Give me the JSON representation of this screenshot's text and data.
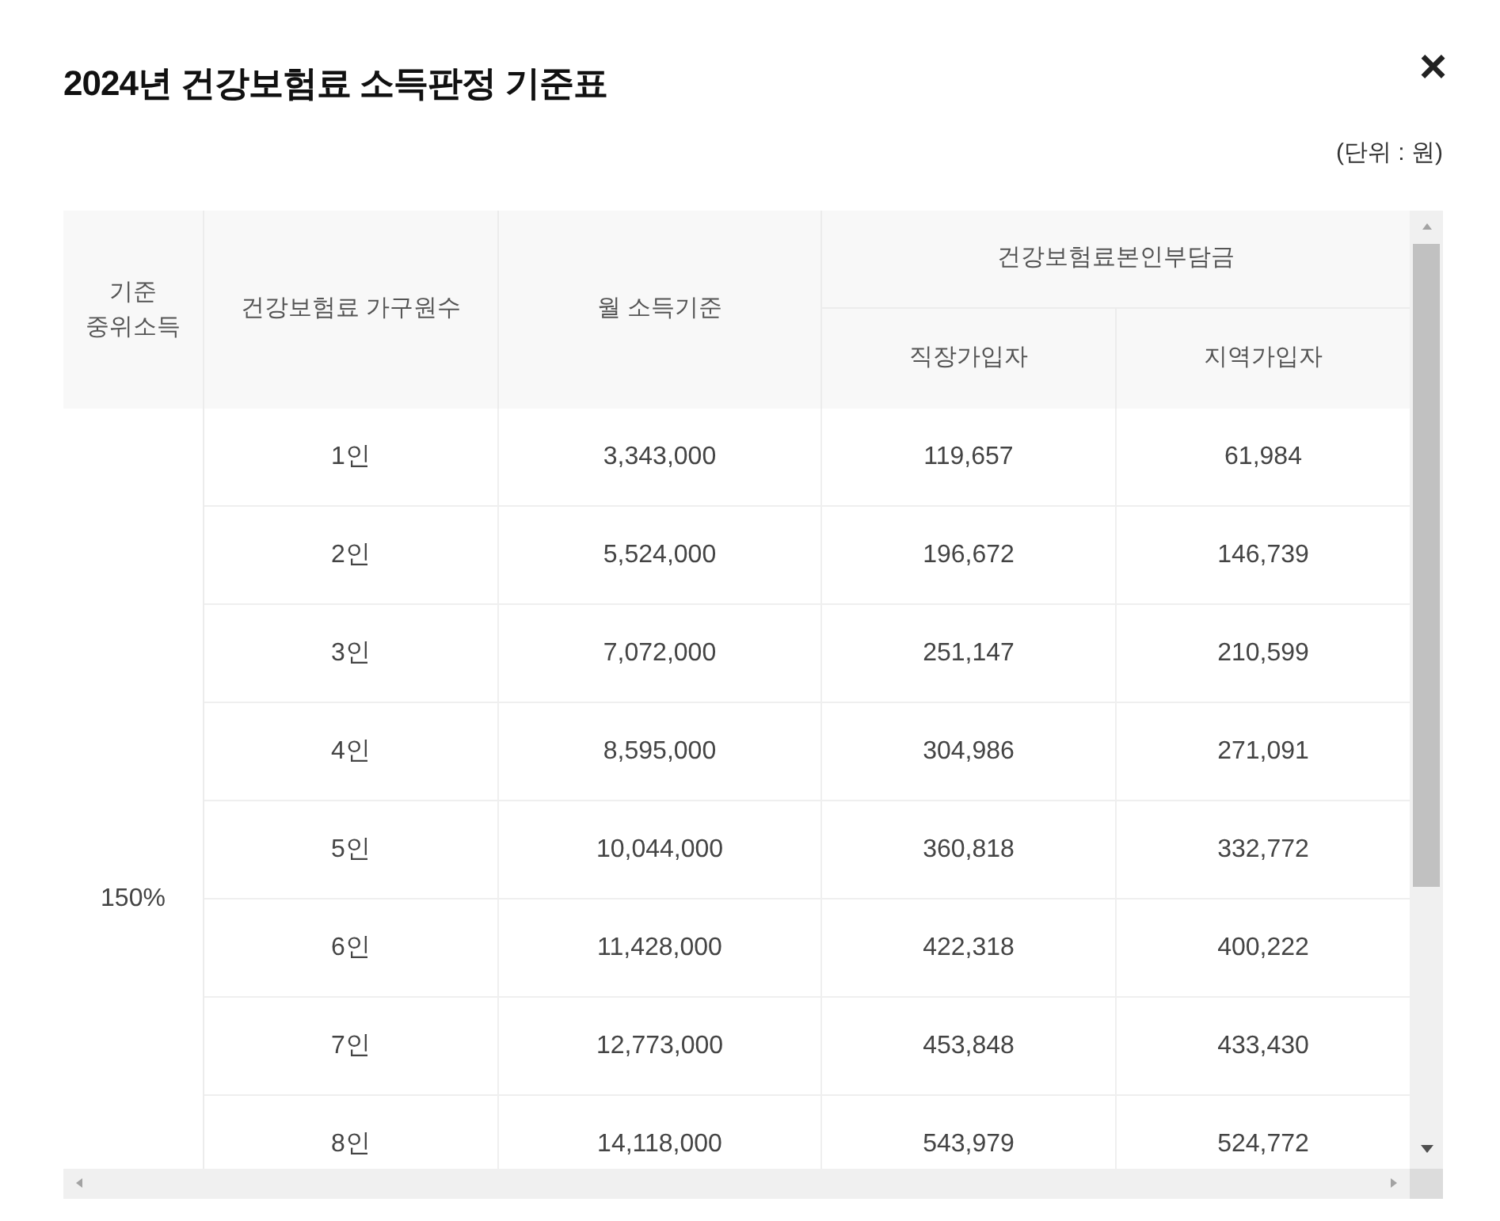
{
  "dialog": {
    "title": "2024년 건강보험료 소득판정 기준표",
    "close": "×",
    "unit_note": "(단위 : 원)"
  },
  "table": {
    "columns": [
      "기준\n중위소득",
      "건강보험료 가구원수",
      "월 소득기준",
      "건강보험료본인부담금"
    ],
    "subcolumns": [
      "직장가입자",
      "지역가입자"
    ],
    "group_label": "150%",
    "rows": [
      {
        "household": "1인",
        "income": "3,343,000",
        "employee": "119,657",
        "regional": "61,984"
      },
      {
        "household": "2인",
        "income": "5,524,000",
        "employee": "196,672",
        "regional": "146,739"
      },
      {
        "household": "3인",
        "income": "7,072,000",
        "employee": "251,147",
        "regional": "210,599"
      },
      {
        "household": "4인",
        "income": "8,595,000",
        "employee": "304,986",
        "regional": "271,091"
      },
      {
        "household": "5인",
        "income": "10,044,000",
        "employee": "360,818",
        "regional": "332,772"
      },
      {
        "household": "6인",
        "income": "11,428,000",
        "employee": "422,318",
        "regional": "400,222"
      },
      {
        "household": "7인",
        "income": "12,773,000",
        "employee": "453,848",
        "regional": "433,430"
      },
      {
        "household": "8인",
        "income": "14,118,000",
        "employee": "543,979",
        "regional": "524,772"
      }
    ]
  }
}
